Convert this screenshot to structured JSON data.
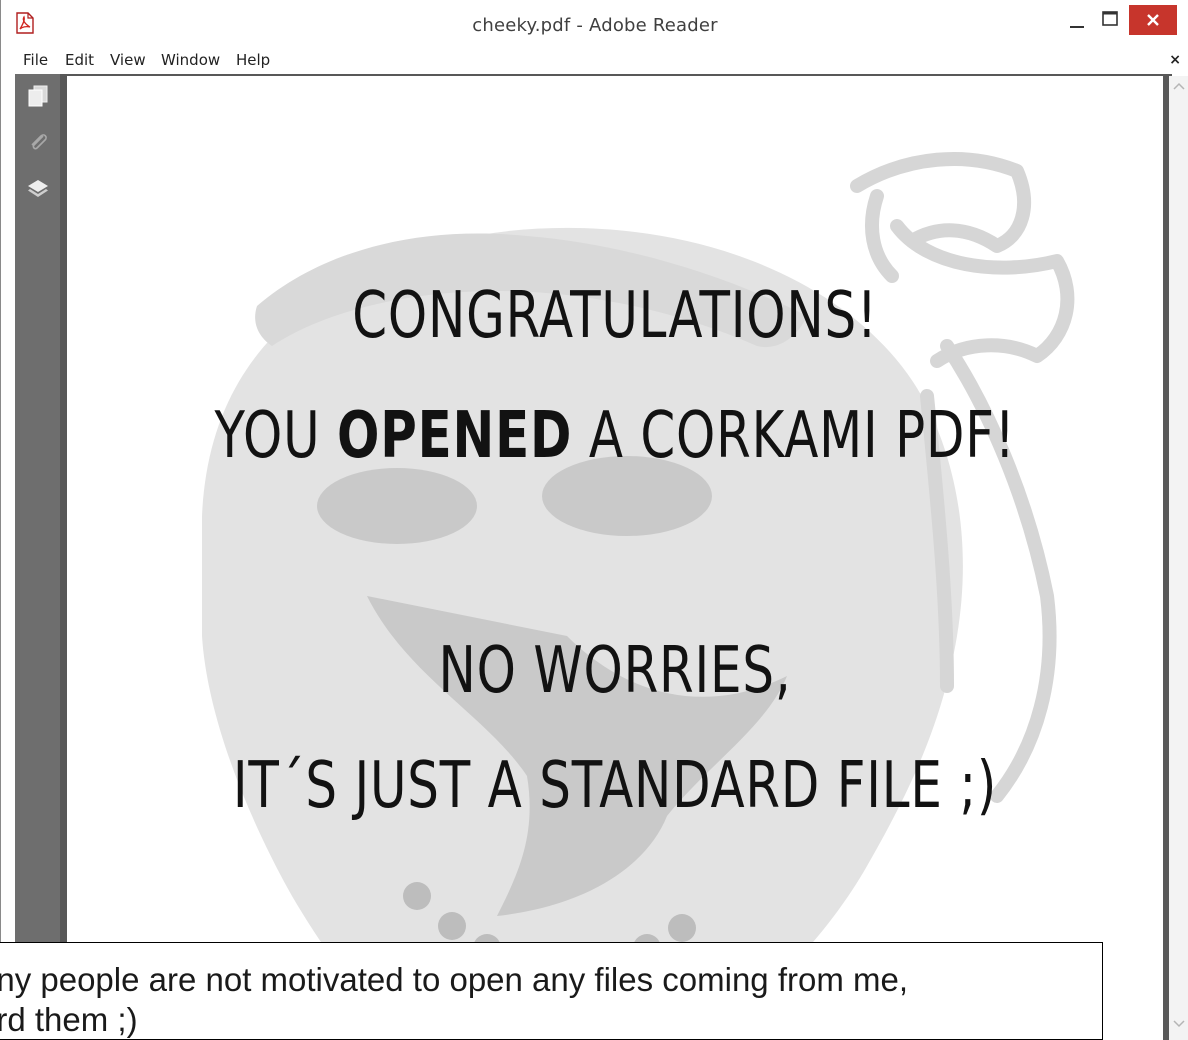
{
  "window": {
    "title": "cheeky.pdf - Adobe Reader",
    "controls": {
      "minimize": "–",
      "maximize": "☐",
      "close": "✕"
    }
  },
  "menu": {
    "items": [
      {
        "label": "File"
      },
      {
        "label": "Edit"
      },
      {
        "label": "View"
      },
      {
        "label": "Window"
      },
      {
        "label": "Help"
      }
    ],
    "close": "×"
  },
  "sidebar": {
    "icons": [
      "pages-icon",
      "attachment-icon",
      "layers-icon"
    ]
  },
  "document": {
    "line1": "CONGRATULATIONS!",
    "line2_pre": "YOU ",
    "line2_bold": "OPENED",
    "line2_post": " A CORKAMI PDF!",
    "line3": "NO WORRIES,",
    "line4": "IT´S JUST A STANDARD FILE ;)"
  },
  "caption": {
    "line1": "any people are not motivated to open any files coming from me,",
    "line2": "ard them ;)"
  },
  "colors": {
    "close_button": "#c7352c",
    "sidebar": "#6e6e6e",
    "frame": "#585858",
    "watermark": "#e3e3e3"
  }
}
